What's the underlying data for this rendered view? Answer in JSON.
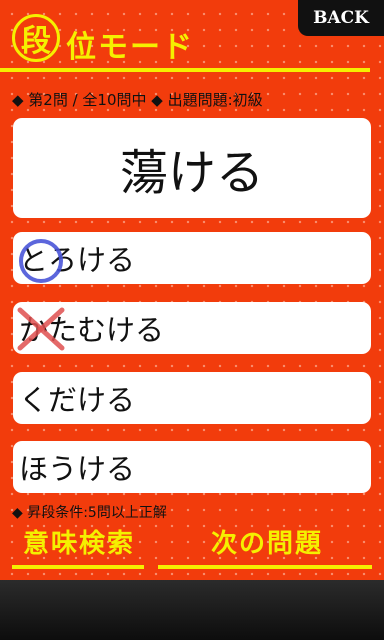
{
  "header": {
    "back_label": "BACK",
    "mode_icon_char": "段",
    "mode_title": "位モード"
  },
  "status": {
    "text": "◆ 第2問 / 全10問中 ◆ 出題問題:初級"
  },
  "question": {
    "word": "蕩ける"
  },
  "choices": [
    {
      "label": "とろける",
      "mark": "correct-circle"
    },
    {
      "label": "かたむける",
      "mark": "wrong-cross"
    },
    {
      "label": "くだける",
      "mark": ""
    },
    {
      "label": "ほうける",
      "mark": ""
    }
  ],
  "footer": {
    "promotion_condition": "◆ 昇段条件:5問以上正解",
    "search_label": "意味検索",
    "next_label": "次の問題"
  },
  "colors": {
    "background": "#f23c0c",
    "accent_yellow": "#f5f000",
    "circle_mark": "#4a55d8",
    "cross_mark": "#e05050"
  }
}
